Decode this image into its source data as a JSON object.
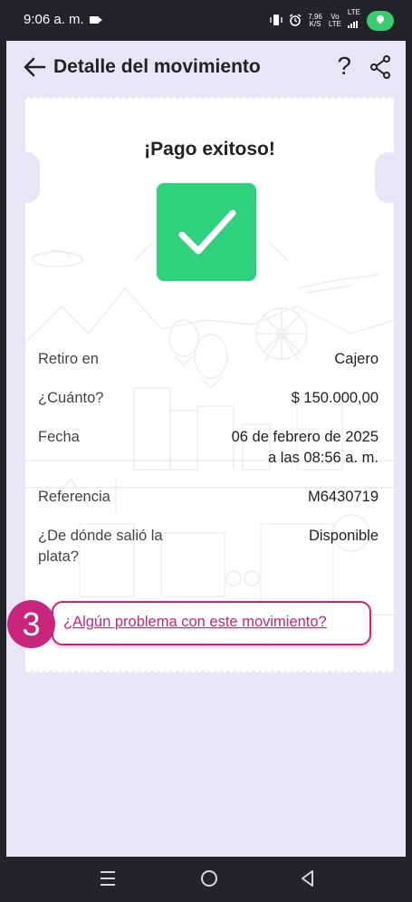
{
  "status_bar": {
    "time": "9:06 a. m.",
    "speed_value": "7,96",
    "speed_unit": "K/S",
    "vo_label": "Vo",
    "lte_label": "LTE",
    "lte_label_2": "LTE",
    "icons": [
      "video-record-icon",
      "vibrate-icon",
      "alarm-icon",
      "signal-icon",
      "location-pill-icon"
    ]
  },
  "header": {
    "title": "Detalle del movimiento",
    "help_label": "?",
    "icons": [
      "back-arrow-icon",
      "share-icon"
    ]
  },
  "receipt": {
    "title": "¡Pago exitoso!",
    "rows": [
      {
        "label": "Retiro en",
        "value": "Cajero"
      },
      {
        "label": "¿Cuánto?",
        "value": "$ 150.000,00"
      },
      {
        "label": "Fecha",
        "value": "06 de febrero de 2025",
        "value_line2": "a las 08:56 a. m."
      },
      {
        "label": "Referencia",
        "value": "M6430719"
      },
      {
        "label": "¿De dónde salió la",
        "label_line2": "plata?",
        "value": "Disponible"
      }
    ],
    "problem_link": "¿Algún problema con este movimiento?"
  },
  "annotation": {
    "step_number": "3",
    "color": "#c8257c"
  },
  "colors": {
    "background": "#e9e4f6",
    "success_green": "#2fd07e",
    "accent_magenta": "#c8257c",
    "system_bar": "#23232a"
  },
  "nav_bar": {
    "icons": [
      "recent-apps-icon",
      "home-icon",
      "back-icon"
    ]
  }
}
